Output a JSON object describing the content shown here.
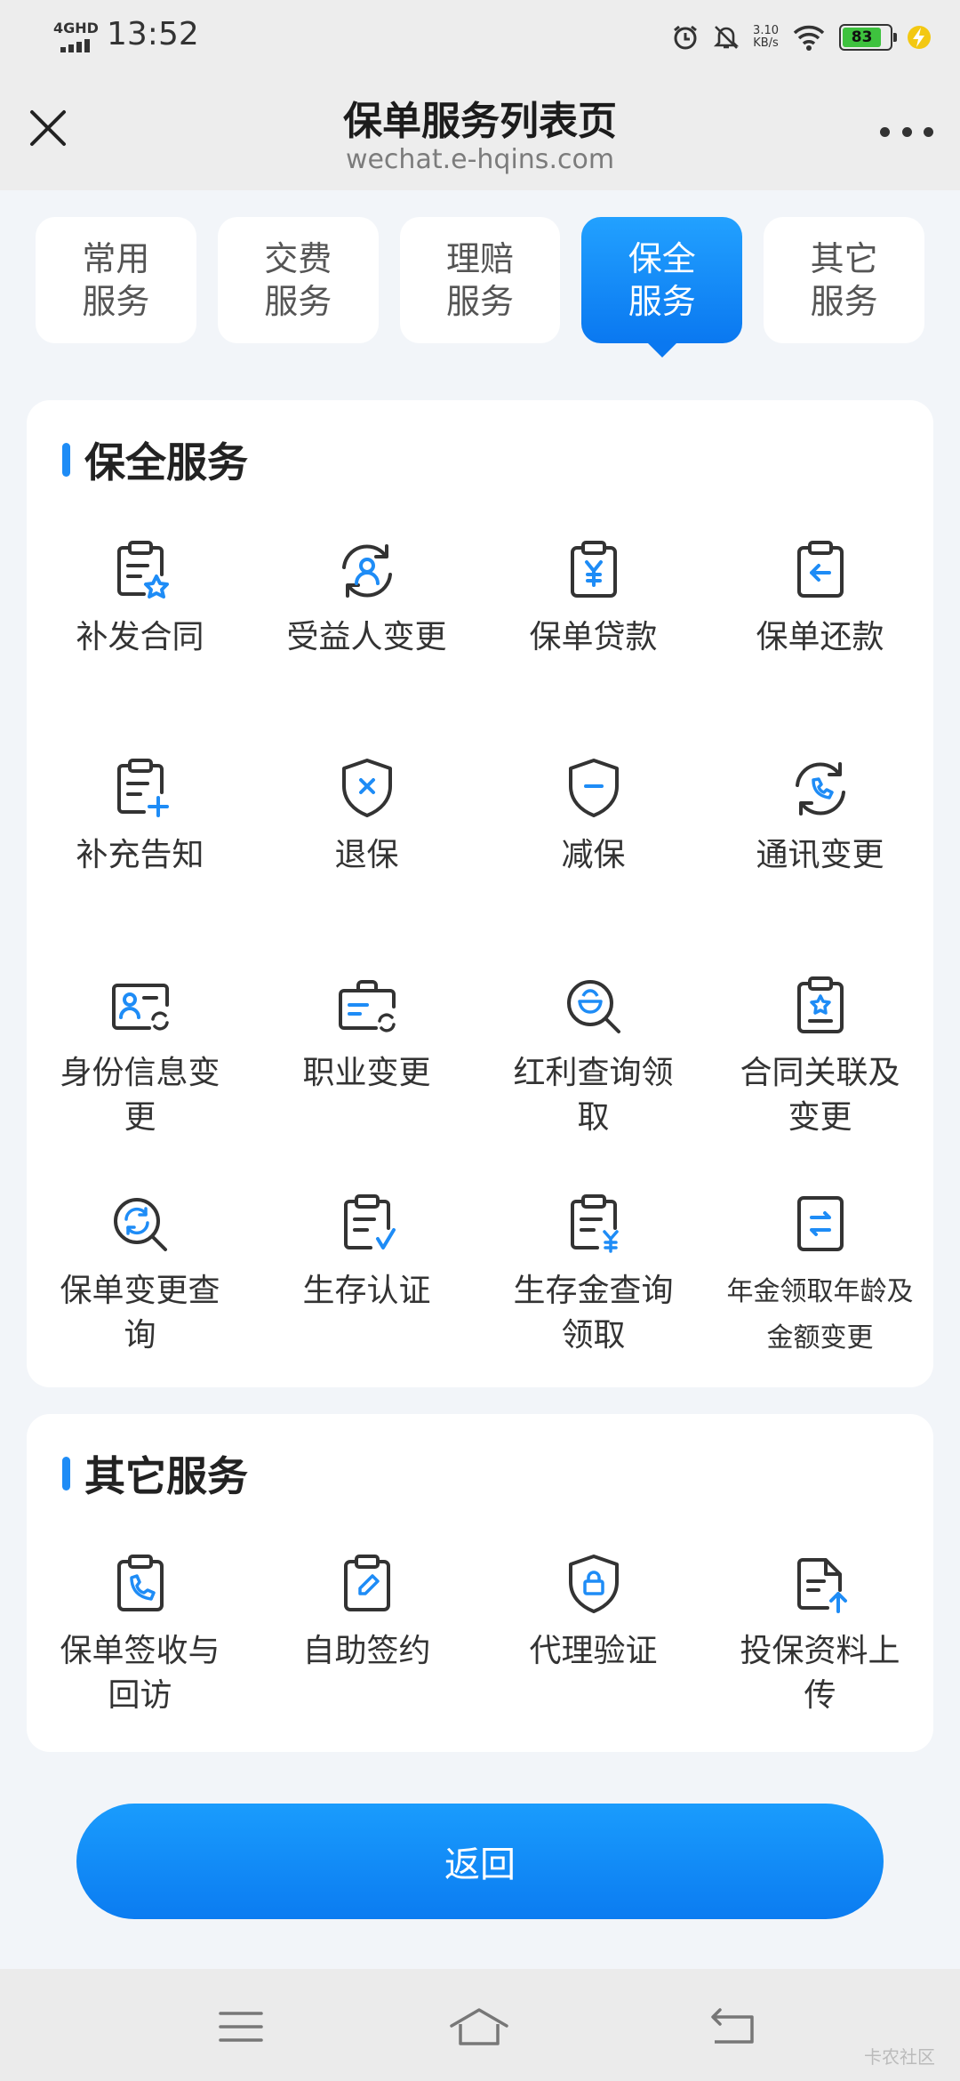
{
  "status_bar": {
    "network": "4GHD",
    "time": "13:52",
    "speed_value": "3.10",
    "speed_unit": "KB/s",
    "battery": "83",
    "battery_level_percent": 83,
    "icons": [
      "alarm-icon",
      "mute-icon",
      "wifi-icon",
      "charging-icon"
    ]
  },
  "header": {
    "title": "保单服务列表页",
    "url": "wechat.e-hqins.com",
    "close_icon": "close-icon",
    "more_icon": "more-icon"
  },
  "tabs": [
    {
      "line1": "常用",
      "line2": "服务",
      "active": false
    },
    {
      "line1": "交费",
      "line2": "服务",
      "active": false
    },
    {
      "line1": "理赔",
      "line2": "服务",
      "active": false
    },
    {
      "line1": "保全",
      "line2": "服务",
      "active": true
    },
    {
      "line1": "其它",
      "line2": "服务",
      "active": false
    }
  ],
  "sections": [
    {
      "title": "保全服务",
      "items": [
        {
          "label": "补发合同",
          "icon": "contract-reissue-icon"
        },
        {
          "label": "受益人变更",
          "icon": "beneficiary-change-icon"
        },
        {
          "label": "保单贷款",
          "icon": "policy-loan-icon"
        },
        {
          "label": "保单还款",
          "icon": "policy-repay-icon"
        },
        {
          "label": "补充告知",
          "icon": "supplement-notice-icon"
        },
        {
          "label": "退保",
          "icon": "surrender-icon"
        },
        {
          "label": "减保",
          "icon": "reduce-coverage-icon"
        },
        {
          "label": "通讯变更",
          "icon": "contact-change-icon"
        },
        {
          "label": "身份信息变更",
          "icon": "id-info-change-icon"
        },
        {
          "label": "职业变更",
          "icon": "occupation-change-icon"
        },
        {
          "label": "红利查询领取",
          "icon": "dividend-query-icon"
        },
        {
          "label": "合同关联及变更",
          "icon": "contract-link-icon"
        },
        {
          "label": "保单变更查询",
          "icon": "change-query-icon"
        },
        {
          "label": "生存认证",
          "icon": "survival-auth-icon"
        },
        {
          "label": "生存金查询领取",
          "icon": "survival-benefit-icon"
        },
        {
          "label": "年金领取年龄及金额变更",
          "icon": "annuity-change-icon"
        }
      ]
    },
    {
      "title": "其它服务",
      "items": [
        {
          "label": "保单签收与回访",
          "icon": "receipt-callback-icon"
        },
        {
          "label": "自助签约",
          "icon": "self-sign-icon"
        },
        {
          "label": "代理验证",
          "icon": "agent-verify-icon"
        },
        {
          "label": "投保资料上传",
          "icon": "document-upload-icon"
        }
      ]
    }
  ],
  "back_button": "返回",
  "watermark": "卡农社区",
  "colors": {
    "accent": "#1e8cf6",
    "icon_stroke": "#333333",
    "background": "#f2f5f9"
  }
}
